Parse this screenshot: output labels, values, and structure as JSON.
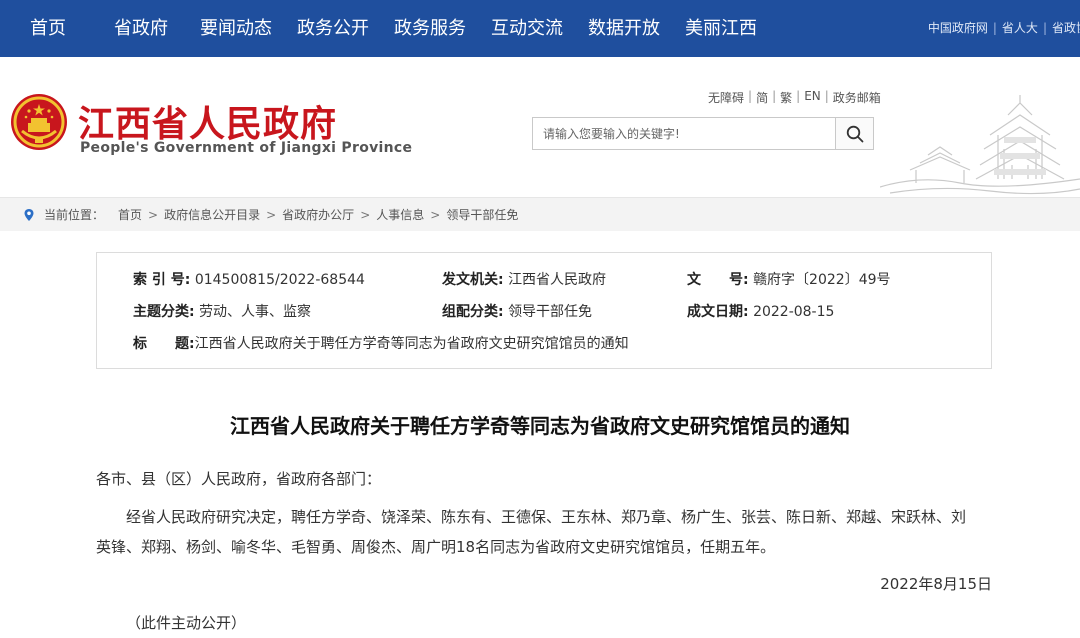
{
  "topnav": {
    "items": [
      "首页",
      "省政府",
      "要闻动态",
      "政务公开",
      "政务服务",
      "互动交流",
      "数据开放",
      "美丽江西"
    ],
    "site_links": [
      "中国政府网",
      "省人大",
      "省政协"
    ]
  },
  "header": {
    "brand_cn": "江西省人民政府",
    "brand_en": "People's Government of Jiangxi Province",
    "util_links": [
      "无障碍",
      "简",
      "繁",
      "EN",
      "政务邮箱"
    ],
    "search_placeholder": "请输入您要输入的关键字!"
  },
  "breadcrumb": {
    "label": "当前位置：",
    "items": [
      "首页",
      "政府信息公开目录",
      "省政府办公厅",
      "人事信息",
      "领导干部任免"
    ]
  },
  "meta": {
    "index_label": "索 引 号:",
    "index_value": "014500815/2022-68544",
    "issuer_label": "发文机关:",
    "issuer_value": "江西省人民政府",
    "docno_label": "文　　号:",
    "docno_value": "赣府字〔2022〕49号",
    "topic_label": "主题分类:",
    "topic_value": "劳动、人事、监察",
    "category_label": "组配分类:",
    "category_value": "领导干部任免",
    "date_label": "成文日期:",
    "date_value": "2022-08-15",
    "title_label": "标　　题:",
    "title_value": "江西省人民政府关于聘任方学奇等同志为省政府文史研究馆馆员的通知"
  },
  "article": {
    "title": "江西省人民政府关于聘任方学奇等同志为省政府文史研究馆馆员的通知",
    "salutation": "各市、县（区）人民政府，省政府各部门：",
    "body": "经省人民政府研究决定，聘任方学奇、饶泽荣、陈东有、王德保、王东林、郑乃章、杨广生、张芸、陈日新、郑越、宋跃林、刘英锋、郑翔、杨剑、喻冬华、毛智勇、周俊杰、周广明18名同志为省政府文史研究馆馆员，任期五年。",
    "date": "2022年8月15日",
    "open_note": "（此件主动公开）"
  },
  "colors": {
    "nav_bg": "#1f4f9e",
    "brand_red": "#c8161d",
    "breadcrumb_bg": "#f3f3f3"
  }
}
